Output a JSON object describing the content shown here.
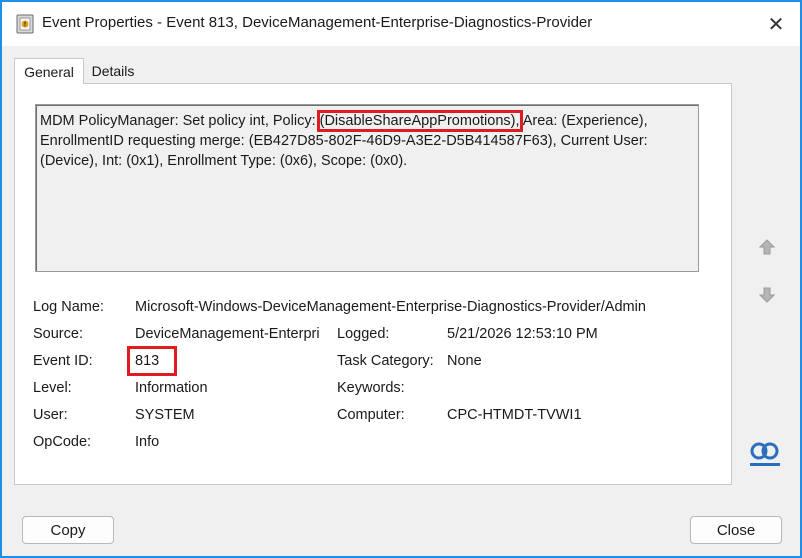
{
  "window": {
    "title": "Event Properties - Event 813, DeviceManagement-Enterprise-Diagnostics-Provider",
    "close_icon": "close-icon"
  },
  "tabs": [
    {
      "label": "General",
      "active": true
    },
    {
      "label": "Details",
      "active": false
    }
  ],
  "message": {
    "before": "MDM PolicyManager: Set policy int, Policy: ",
    "highlight": "(DisableShareAppPromotions),",
    "after": " Area: (Experience), EnrollmentID requesting merge: (EB427D85-802F-46D9-A3E2-D5B414587F63), Current User: (Device), Int: (0x1), Enrollment Type: (0x6), Scope: (0x0)."
  },
  "fields": {
    "log_name": {
      "label": "Log Name:",
      "value": "Microsoft-Windows-DeviceManagement-Enterprise-Diagnostics-Provider/Admin"
    },
    "source": {
      "label": "Source:",
      "value": "DeviceManagement-Enterpri"
    },
    "logged": {
      "label": "Logged:",
      "value": "5/21/2026 12:53:10 PM"
    },
    "event_id": {
      "label": "Event ID:",
      "value": "813"
    },
    "task_category": {
      "label": "Task Category:",
      "value": "None"
    },
    "level": {
      "label": "Level:",
      "value": "Information"
    },
    "keywords": {
      "label": "Keywords:",
      "value": ""
    },
    "user": {
      "label": "User:",
      "value": "SYSTEM"
    },
    "computer": {
      "label": "Computer:",
      "value": "CPC-HTMDT-TVWI1"
    },
    "opcode": {
      "label": "OpCode:",
      "value": "Info"
    }
  },
  "scroll": {
    "up_icon": "arrow-up-icon",
    "down_icon": "arrow-down-icon"
  },
  "buttons": {
    "copy": "Copy",
    "close": "Close"
  },
  "colors": {
    "highlight_box": "#e01b24",
    "window_border": "#1f8fe6"
  }
}
